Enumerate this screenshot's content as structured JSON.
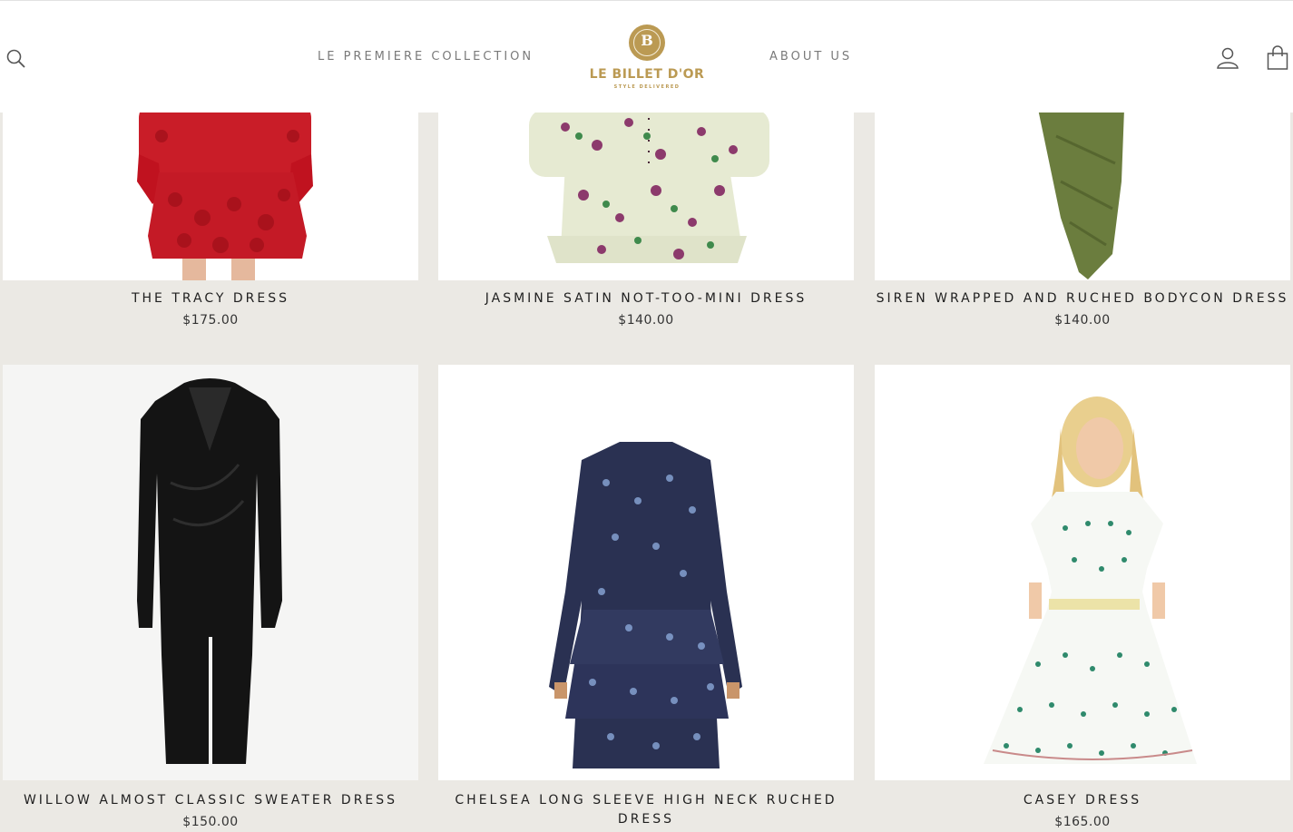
{
  "header": {
    "nav_left": "LE PREMIERE COLLECTION",
    "nav_right": "ABOUT US",
    "logo_mark": "B",
    "logo_text": "LE BILLET D'OR",
    "logo_tagline": "STYLE DELIVERED",
    "icons": [
      "search-icon",
      "account-icon",
      "cart-icon"
    ]
  },
  "products": [
    {
      "title": "THE TRACY DRESS",
      "price": "$175.00"
    },
    {
      "title": "JASMINE SATIN NOT-TOO-MINI DRESS",
      "price": "$140.00"
    },
    {
      "title": "SIREN WRAPPED AND RUCHED BODYCON DRESS",
      "price": "$140.00"
    },
    {
      "title": "WILLOW ALMOST CLASSIC SWEATER DRESS",
      "price": "$150.00"
    },
    {
      "title": "CHELSEA LONG SLEEVE HIGH NECK RUCHED DRESS",
      "price": ""
    },
    {
      "title": "CASEY DRESS",
      "price": "$165.00"
    }
  ],
  "colors": {
    "brand_gold": "#bb9a53",
    "page_background": "#ebe9e4",
    "header_background": "#ffffff"
  }
}
